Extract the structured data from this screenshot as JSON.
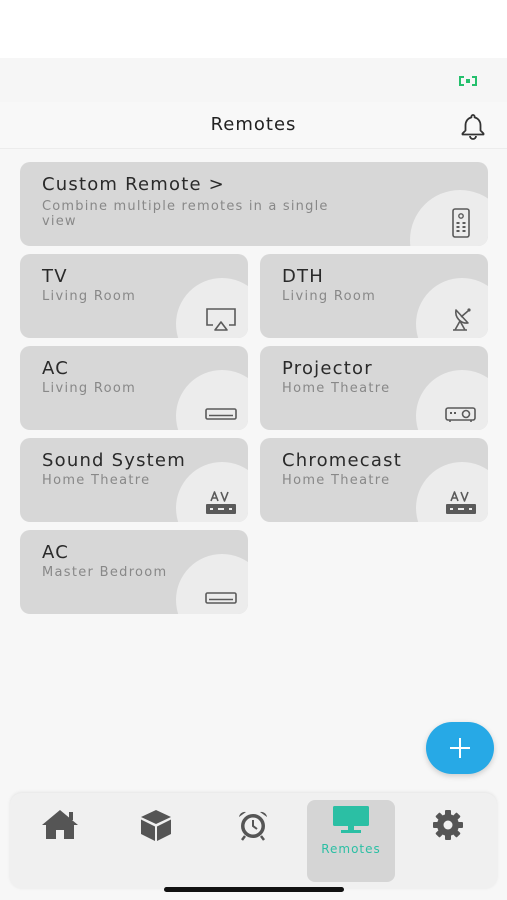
{
  "header": {
    "title": "Remotes"
  },
  "custom_remote": {
    "title": "Custom Remote",
    "chevron": ">",
    "description": "Combine multiple remotes in a single view",
    "icon": "remote-control-icon"
  },
  "remotes": [
    {
      "name": "TV",
      "room": "Living Room",
      "icon": "tv-cast-icon"
    },
    {
      "name": "DTH",
      "room": "Living Room",
      "icon": "satellite-dish-icon"
    },
    {
      "name": "AC",
      "room": "Living Room",
      "icon": "air-conditioner-icon"
    },
    {
      "name": "Projector",
      "room": "Home Theatre",
      "icon": "projector-icon"
    },
    {
      "name": "Sound System",
      "room": "Home Theatre",
      "icon": "av-receiver-icon"
    },
    {
      "name": "Chromecast",
      "room": "Home Theatre",
      "icon": "av-receiver-icon"
    },
    {
      "name": "AC",
      "room": "Master Bedroom",
      "icon": "air-conditioner-icon"
    }
  ],
  "fab": {
    "icon": "plus-icon"
  },
  "nav": {
    "active": "remotes",
    "items": [
      {
        "id": "home",
        "icon": "home-icon"
      },
      {
        "id": "devices",
        "icon": "cube-icon"
      },
      {
        "id": "alarms",
        "icon": "alarm-clock-icon"
      },
      {
        "id": "remotes",
        "label": "Remotes",
        "icon": "monitor-icon"
      },
      {
        "id": "settings",
        "icon": "gear-icon"
      }
    ]
  },
  "colors": {
    "accent": "#27a9e6",
    "active_nav": "#2bbfa4",
    "battery": "#25c06d",
    "card": "#d7d7d7",
    "icon": "#5a5a5a"
  }
}
